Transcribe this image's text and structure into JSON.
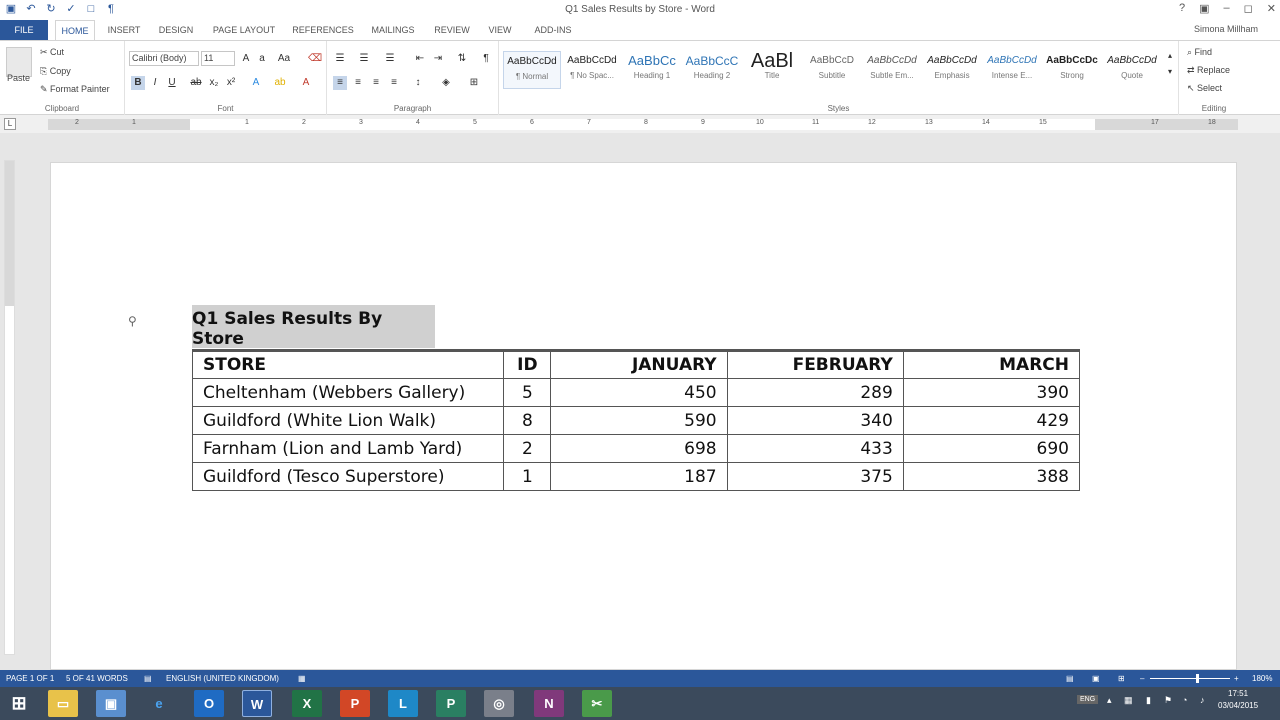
{
  "window": {
    "title": "Q1 Sales Results by Store - Word",
    "controls": [
      "?",
      "▣",
      "–",
      "◻",
      "✕"
    ]
  },
  "qat": [
    "save-icon",
    "undo-icon",
    "redo-icon",
    "spelling-icon",
    "new-icon",
    "show-marks-icon"
  ],
  "tabs": {
    "file": "FILE",
    "items": [
      "HOME",
      "INSERT",
      "DESIGN",
      "PAGE LAYOUT",
      "REFERENCES",
      "MAILINGS",
      "REVIEW",
      "VIEW",
      "ADD-INS"
    ],
    "active": "HOME"
  },
  "user": {
    "name": "Simona Millham"
  },
  "clipboard": {
    "paste": "Paste",
    "cut": "Cut",
    "copy": "Copy",
    "format_painter": "Format Painter",
    "label": "Clipboard"
  },
  "font": {
    "name": "Calibri (Body)",
    "size": "11",
    "label": "Font"
  },
  "paragraph": {
    "label": "Paragraph"
  },
  "styles": {
    "label": "Styles",
    "items": [
      {
        "preview": "AaBbCcDd",
        "name": "¶ Normal"
      },
      {
        "preview": "AaBbCcDd",
        "name": "¶ No Spac..."
      },
      {
        "preview": "AaBbCc",
        "name": "Heading 1"
      },
      {
        "preview": "AaBbCcC",
        "name": "Heading 2"
      },
      {
        "preview": "AaBl",
        "name": "Title"
      },
      {
        "preview": "AaBbCcD",
        "name": "Subtitle"
      },
      {
        "preview": "AaBbCcDd",
        "name": "Subtle Em..."
      },
      {
        "preview": "AaBbCcDd",
        "name": "Emphasis"
      },
      {
        "preview": "AaBbCcDd",
        "name": "Intense E..."
      },
      {
        "preview": "AaBbCcDc",
        "name": "Strong"
      },
      {
        "preview": "AaBbCcDd",
        "name": "Quote"
      }
    ]
  },
  "editing": {
    "find": "Find",
    "replace": "Replace",
    "select": "Select",
    "label": "Editing"
  },
  "ruler": {
    "numbers": [
      "2",
      "1",
      "1",
      "2",
      "3",
      "4",
      "5",
      "6",
      "7",
      "8",
      "9",
      "10",
      "11",
      "12",
      "13",
      "14",
      "15",
      "17",
      "18"
    ]
  },
  "document": {
    "title": "Q1 Sales Results By Store",
    "table": {
      "headers": [
        "STORE",
        "ID",
        "JANUARY",
        "FEBRUARY",
        "MARCH"
      ],
      "rows": [
        [
          "Cheltenham (Webbers Gallery)",
          "5",
          "450",
          "289",
          "390"
        ],
        [
          "Guildford (White Lion Walk)",
          "8",
          "590",
          "340",
          "429"
        ],
        [
          "Farnham (Lion and Lamb Yard)",
          "2",
          "698",
          "433",
          "690"
        ],
        [
          "Guildford (Tesco Superstore)",
          "1",
          "187",
          "375",
          "388"
        ]
      ]
    }
  },
  "status": {
    "page": "PAGE 1 OF 1",
    "words": "5 OF 41 WORDS",
    "language": "ENGLISH (UNITED KINGDOM)",
    "zoom": "180%"
  },
  "taskbar": {
    "time": "17:51",
    "date": "03/04/2015"
  },
  "colors": {
    "accent": "#2b579a",
    "taskbar": "#3b4a5c"
  }
}
